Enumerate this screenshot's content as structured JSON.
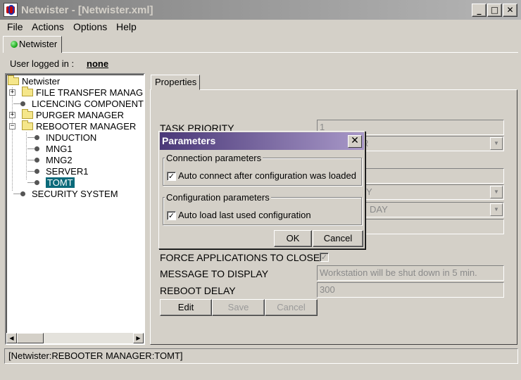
{
  "window": {
    "title": "Netwister  - [Netwister.xml]",
    "minimize": "_",
    "maximize": "□",
    "close": "✕"
  },
  "menu": [
    "File",
    "Actions",
    "Options",
    "Help"
  ],
  "main_tab": {
    "label": "Netwister"
  },
  "user": {
    "label": "User logged in :",
    "value": "none"
  },
  "tree": {
    "root": "Netwister",
    "items": [
      {
        "label": "FILE TRANSFER MANAGER",
        "type": "folder",
        "expander": "+"
      },
      {
        "label": "LICENCING COMPONENT",
        "type": "leaf"
      },
      {
        "label": "PURGER MANAGER",
        "type": "folder",
        "expander": "+"
      },
      {
        "label": "REBOOTER MANAGER",
        "type": "folder",
        "expander": "−"
      },
      {
        "label": "INDUCTION",
        "type": "leaf"
      },
      {
        "label": "MNG1",
        "type": "leaf"
      },
      {
        "label": "MNG2",
        "type": "leaf"
      },
      {
        "label": "SERVER1",
        "type": "leaf"
      },
      {
        "label": "TOMT",
        "type": "leaf",
        "selected": true
      },
      {
        "label": "SECURITY SYSTEM",
        "type": "leaf"
      }
    ],
    "scroll_left": "◀",
    "scroll_right": "▶"
  },
  "properties": {
    "tab_label": "Properties",
    "task_priority_label": "TASK PRIORITY",
    "task_priority_value": "1",
    "combo1_value": "R",
    "combo2_value": "Y",
    "combo3_value": "DAY",
    "force_close_label": "FORCE APPLICATIONS TO CLOSE",
    "force_close_checked": "✓",
    "message_label": "MESSAGE TO DISPLAY",
    "message_value": "Workstation will be shut down in 5 min.",
    "reboot_delay_label": "REBOOT DELAY",
    "reboot_delay_value": "300",
    "edit_label": "Edit",
    "save_label": "Save",
    "cancel_label": "Cancel",
    "combo_arrow": "▼"
  },
  "dialog": {
    "title": "Parameters",
    "close": "✕",
    "connection_group": "Connection parameters",
    "auto_connect_label": "Auto connect after configuration was loaded",
    "auto_connect_checked": "✓",
    "configuration_group": "Configuration parameters",
    "auto_load_label": "Auto load last used configuration",
    "auto_load_checked": "✓",
    "ok_label": "OK",
    "cancel_label": "Cancel"
  },
  "status": {
    "text": "[Netwister:REBOOTER MANAGER:TOMT]"
  }
}
